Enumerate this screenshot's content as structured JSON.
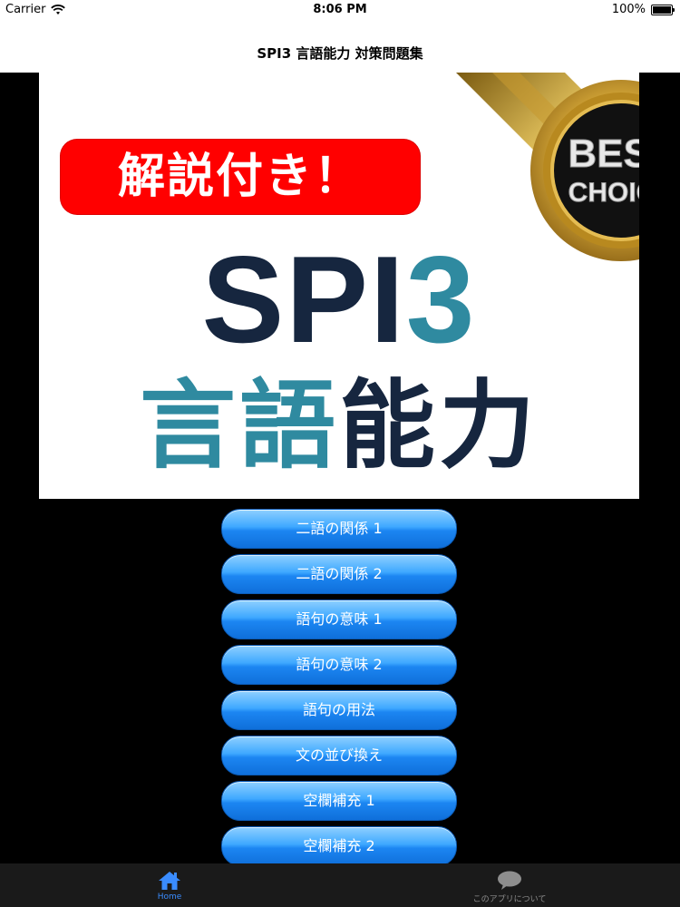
{
  "status_bar": {
    "carrier": "Carrier",
    "time": "8:06 PM",
    "battery": "100%"
  },
  "nav": {
    "title": "SPI3 言語能力 対策問題集"
  },
  "banner": {
    "badge_text": "解説付き！",
    "title_main_prefix": "SPI",
    "title_main_number": "3",
    "title_sub_a": "言語",
    "title_sub_b": "能力",
    "ribbon_line1": "BEST",
    "ribbon_line2": "CHOICE"
  },
  "menu": {
    "items": [
      "二語の関係 1",
      "二語の関係 2",
      "語句の意味 1",
      "語句の意味 2",
      "語句の用法",
      "文の並び換え",
      "空欄補充 1",
      "空欄補充 2"
    ]
  },
  "tab_bar": {
    "home_label": "Home",
    "about_label": "このアプリについて"
  },
  "colors": {
    "accent": "#3a8cff",
    "title_dark": "#16263f",
    "title_teal": "#2f8aa0",
    "badge_red": "#ff0000",
    "button_blue": "#1c86f2"
  }
}
